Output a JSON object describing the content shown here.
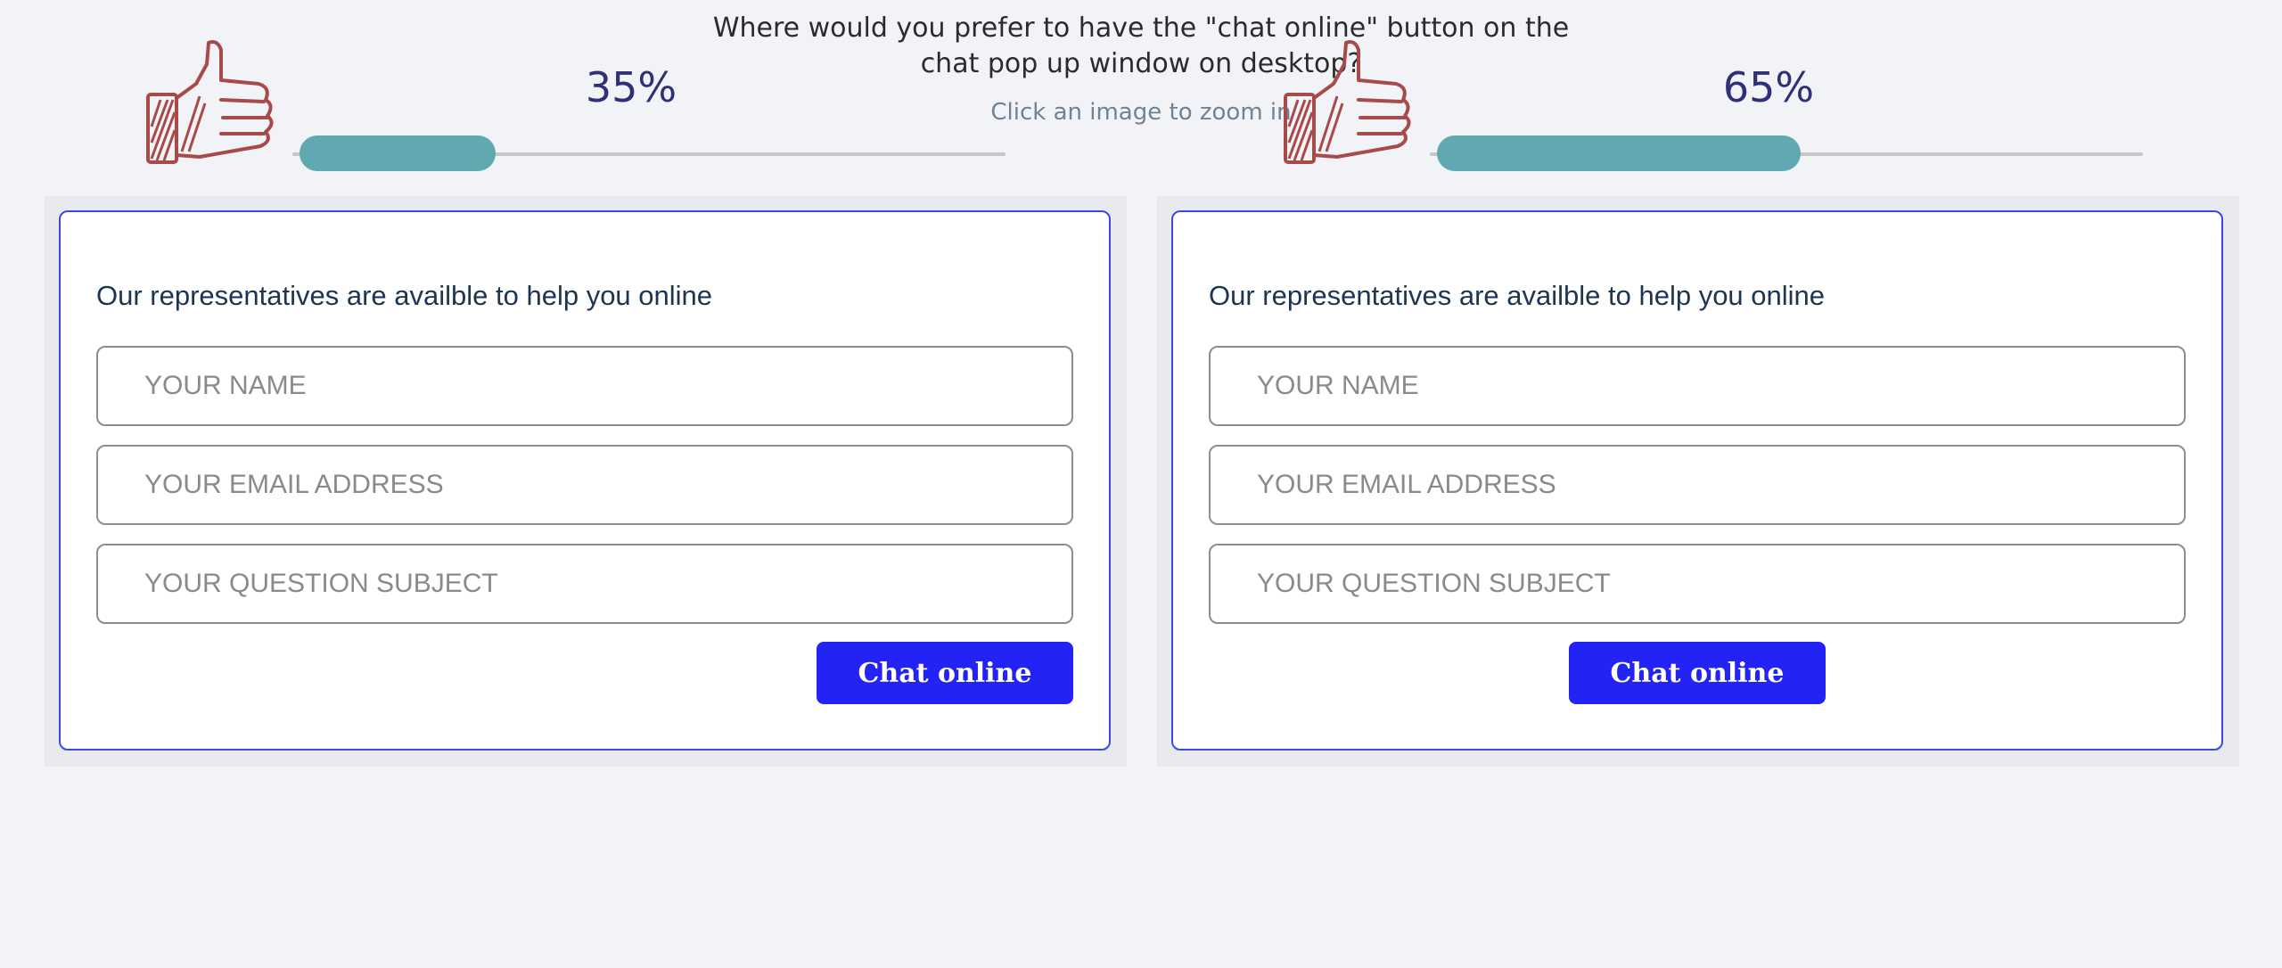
{
  "poll": {
    "question": "Where would you prefer to have the \"chat online\" button on the chat pop up window on desktop?",
    "hint": "Click an image to zoom in"
  },
  "options": [
    {
      "percent_label": "35%",
      "percent_value": 35,
      "card": {
        "title": "Our representatives are availble to help you online",
        "name_placeholder": "YOUR NAME",
        "email_placeholder": "YOUR EMAIL ADDRESS",
        "subject_placeholder": "YOUR QUESTION SUBJECT",
        "button_label": "Chat online",
        "button_position": "right"
      }
    },
    {
      "percent_label": "65%",
      "percent_value": 65,
      "card": {
        "title": "Our representatives are availble to help you online",
        "name_placeholder": "YOUR NAME",
        "email_placeholder": "YOUR EMAIL ADDRESS",
        "subject_placeholder": "YOUR QUESTION SUBJECT",
        "button_label": "Chat online",
        "button_position": "center"
      }
    }
  ],
  "icons": {
    "vote": "thumbs-up-icon"
  },
  "colors": {
    "background": "#f2f3f7",
    "bar_fill": "#60a9b0",
    "percent_text": "#2f3076",
    "button": "#2323f5",
    "card_border": "#3b49e6",
    "thumb": "#a94a4a"
  }
}
